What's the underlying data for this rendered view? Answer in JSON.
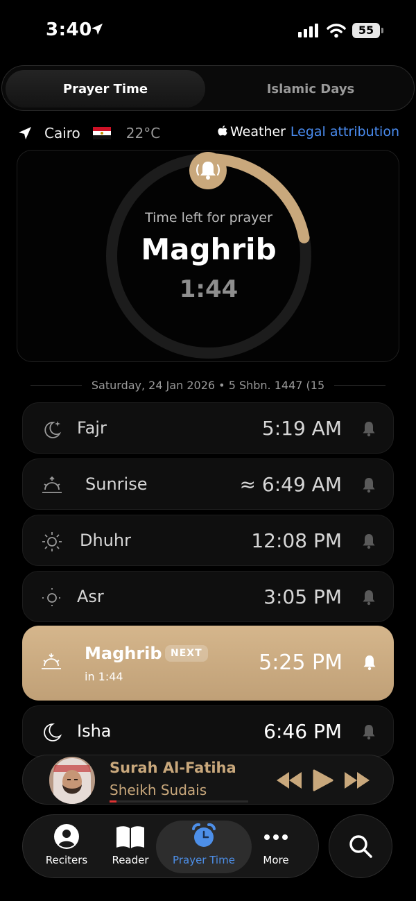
{
  "status_bar": {
    "time": "3:40",
    "battery": "55"
  },
  "segmented": {
    "tabs": [
      "Prayer Time",
      "Islamic Days"
    ],
    "active_index": 0
  },
  "location": {
    "city": "Cairo",
    "temperature": "22°C",
    "weather_label": "Weather",
    "legal_link": "Legal attribution"
  },
  "countdown": {
    "label": "Time left for prayer",
    "prayer": "Maghrib",
    "remaining": "1:44",
    "progress_fraction": 0.22,
    "accent_color": "#c9a87c"
  },
  "date_line": "Saturday, 24 Jan 2026  •  5 Shbn. 1447 (15",
  "prayers": [
    {
      "name": "Fajr",
      "time": "5:19 AM",
      "icon": "moon-stars-icon"
    },
    {
      "name": "Sunrise",
      "time": "≈ 6:49 AM",
      "icon": "sunrise-icon"
    },
    {
      "name": "Dhuhr",
      "time": "12:08 PM",
      "icon": "sun-icon"
    },
    {
      "name": "Asr",
      "time": "3:05 PM",
      "icon": "sun-icon"
    },
    {
      "name": "Maghrib",
      "time": "5:25 PM",
      "icon": "sunset-icon",
      "badge": "NEXT",
      "sub": "in 1:44"
    },
    {
      "name": "Isha",
      "time": "6:46 PM",
      "icon": "moon-icon"
    }
  ],
  "player": {
    "title": "Surah Al-Fatiha",
    "artist": "Sheikh Sudais"
  },
  "tabbar": {
    "tabs": [
      {
        "label": "Reciters",
        "icon": "person-circle-icon"
      },
      {
        "label": "Reader",
        "icon": "book-icon"
      },
      {
        "label": "Prayer Time",
        "icon": "alarm-clock-icon"
      },
      {
        "label": "More",
        "icon": "ellipsis-icon"
      }
    ],
    "active_index": 2
  }
}
